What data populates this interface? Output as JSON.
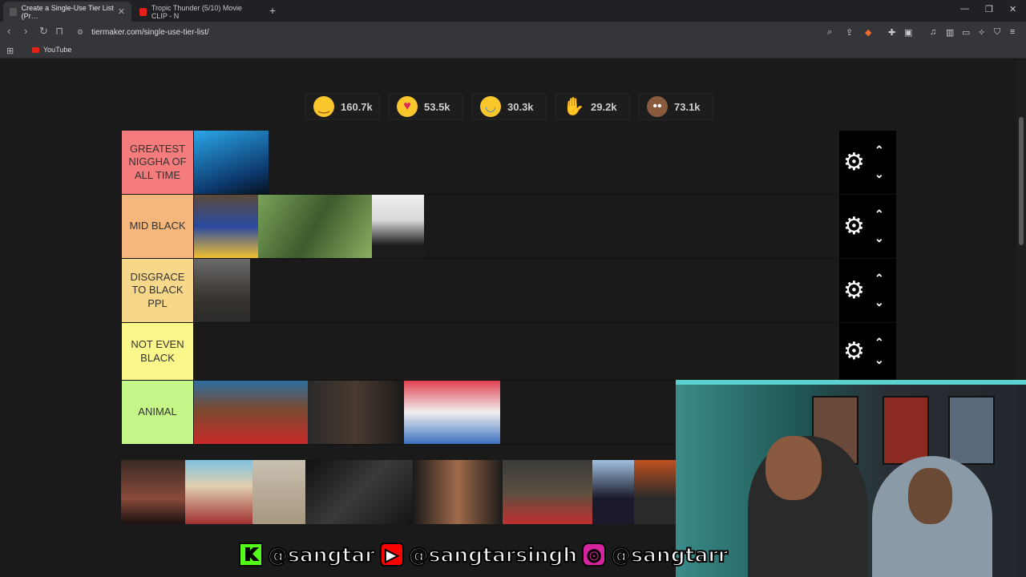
{
  "browser": {
    "tabs": [
      {
        "title": "Create a Single-Use Tier List (Pr…",
        "active": true
      },
      {
        "title": "Tropic Thunder (5/10) Movie CLIP - N",
        "active": false
      }
    ],
    "url": "tiermaker.com/single-use-tier-list/",
    "bookmarks": [
      {
        "label": "YouTube"
      }
    ]
  },
  "reactions": [
    {
      "emoji": "grinning-face",
      "count": "160.7k"
    },
    {
      "emoji": "heart-eyes-face",
      "count": "53.5k"
    },
    {
      "emoji": "laughing-face",
      "count": "30.3k"
    },
    {
      "emoji": "raised-hands",
      "count": "29.2k"
    },
    {
      "emoji": "pile-of-poo",
      "count": "73.1k"
    }
  ],
  "tiers": [
    {
      "label": "GREATEST NIGGHA OF ALL TIME",
      "color": "#f47c7c",
      "items": 1
    },
    {
      "label": "MID BLACK",
      "color": "#f5b77c",
      "items": 3
    },
    {
      "label": "DISGRACE TO BLACK PPL",
      "color": "#f7d88a",
      "items": 1
    },
    {
      "label": "NOT EVEN BLACK",
      "color": "#fbf78a",
      "items": 0
    },
    {
      "label": "ANIMAL",
      "color": "#c6f58a",
      "items": 3
    }
  ],
  "overlay": {
    "kick": "@sangtar",
    "youtube": "@sangtarsingh",
    "instagram": "@sangtarr"
  }
}
